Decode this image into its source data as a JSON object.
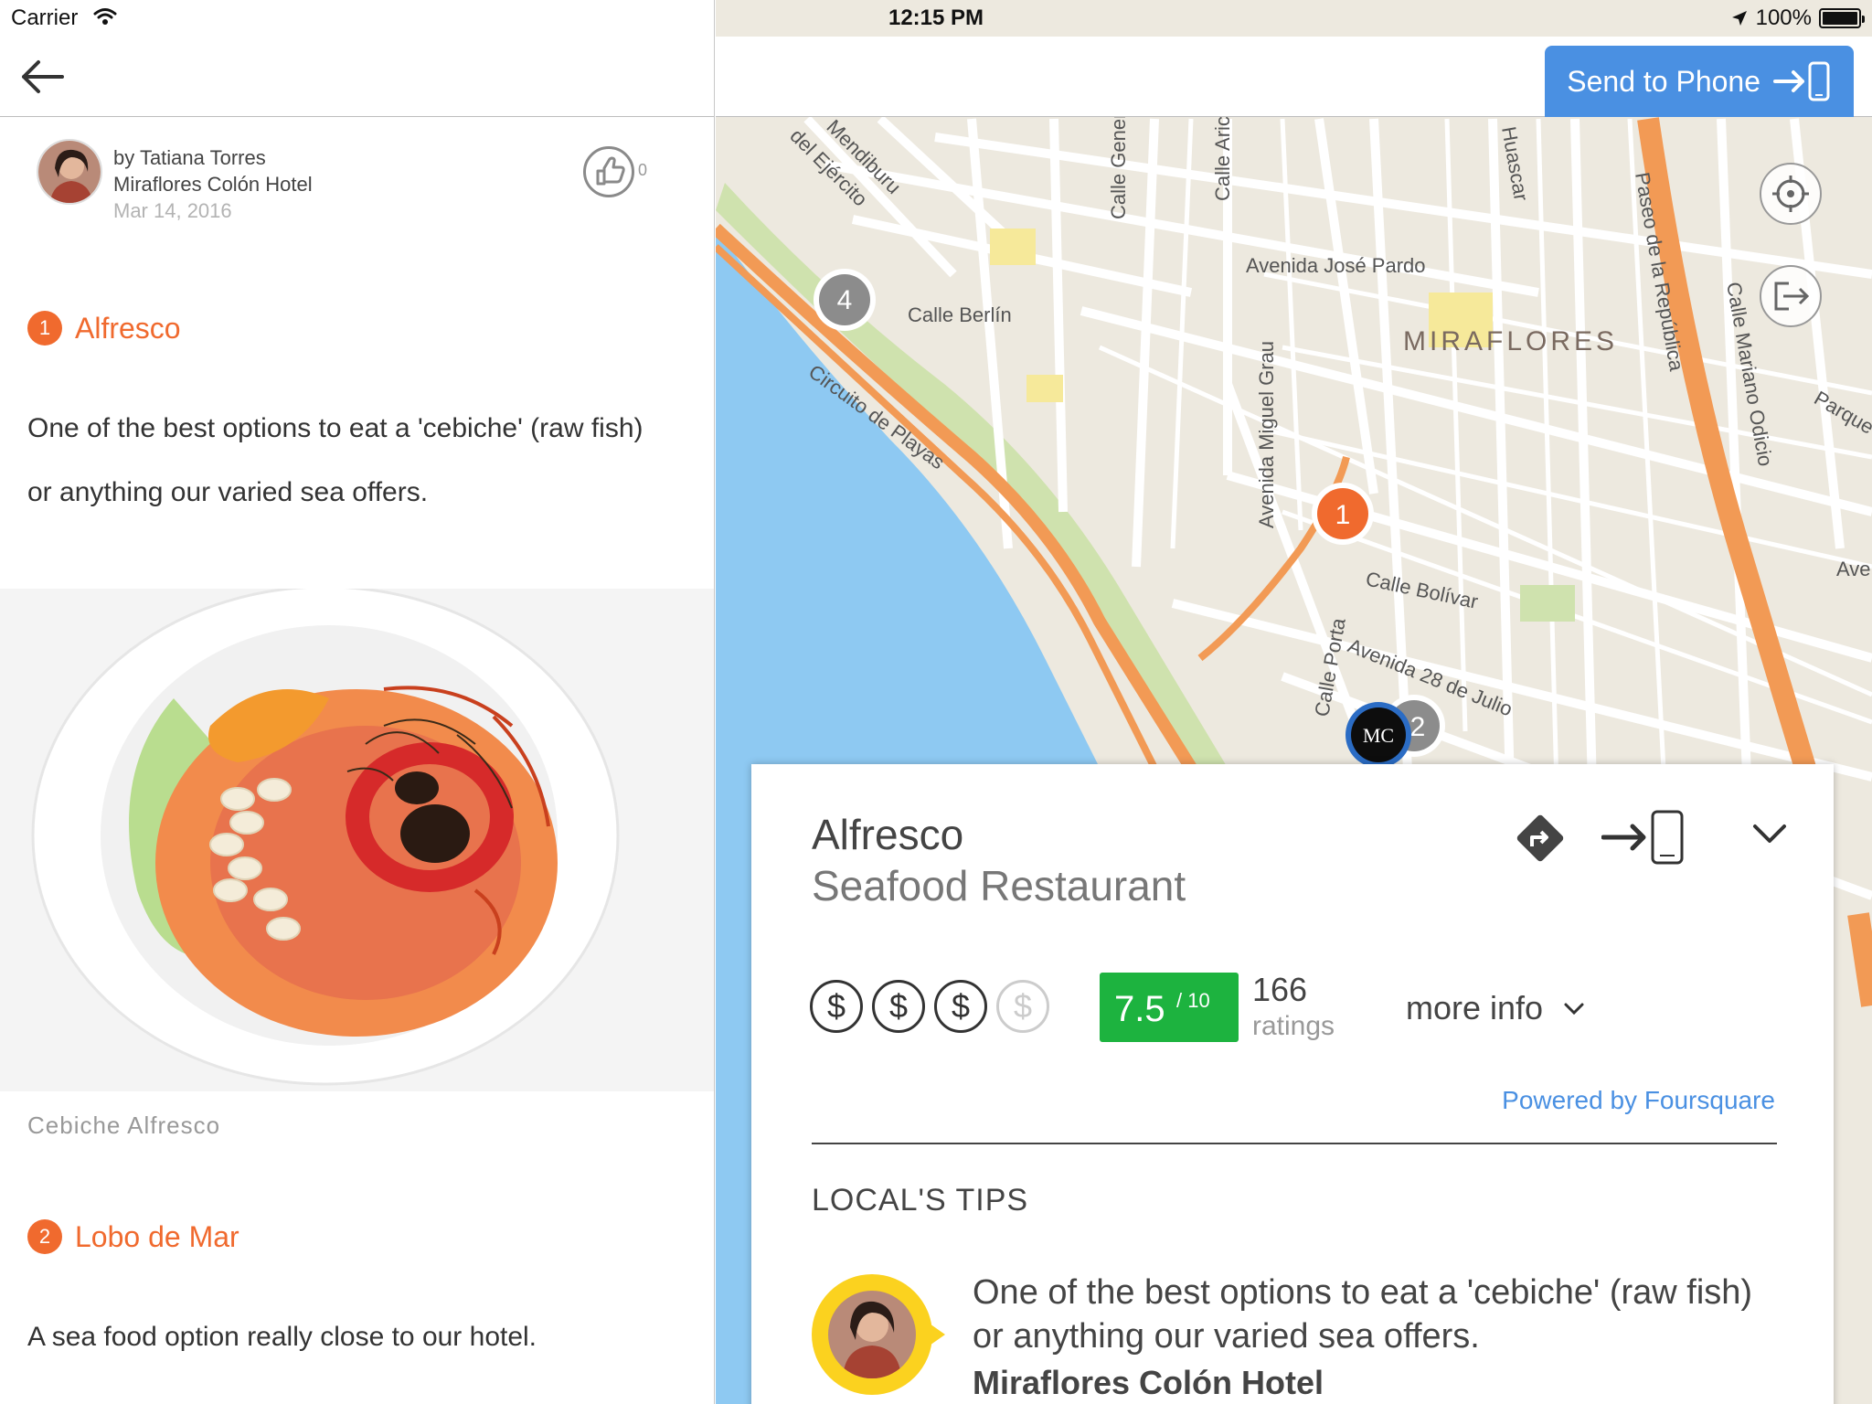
{
  "status_bar": {
    "carrier": "Carrier",
    "time": "12:15 PM",
    "battery": "100%"
  },
  "post": {
    "byline": "by Tatiana Torres",
    "hotel": "Miraflores Colón Hotel",
    "date": "Mar 14, 2016",
    "likes": "0"
  },
  "places": [
    {
      "number": "1",
      "name": "Alfresco",
      "description": "One of the best options to eat a 'cebiche' (raw fish) or anything our varied sea offers.",
      "photo_caption": "Cebiche Alfresco"
    },
    {
      "number": "2",
      "name": "Lobo de Mar",
      "description": "A sea food option really close to our hotel."
    }
  ],
  "map": {
    "send_to_phone_label": "Send to Phone",
    "district_label": "MIRAFLORES",
    "street_labels": {
      "jose_pardo": "Avenida José Pardo",
      "berlin": "Calle Berlín",
      "circuito": "Circuito de Playas",
      "bolivar": "Calle Bolívar",
      "veintiocho": "Avenida 28 de Julio",
      "grau": "Avenida Miguel Grau",
      "porta": "Calle Porta",
      "republica": "Paseo de la República",
      "odicio": "Calle Mariano Odicio",
      "mendiburu": "Mendiburu",
      "ejercito": "del Ejército",
      "general": "Calle Gener",
      "arica": "Calle Aric",
      "huascar": "Huascar",
      "parque": "Parque",
      "avenida_edge": "Aven"
    },
    "markers": [
      {
        "label": "4"
      },
      {
        "label": "1"
      },
      {
        "label": "2"
      }
    ],
    "hotel_pin_label": "MC"
  },
  "venue_card": {
    "name": "Alfresco",
    "category": "Seafood Restaurant",
    "price_tier": 3,
    "price_max": 4,
    "price_symbol": "$",
    "rating": "7.5",
    "rating_scale": "/ 10",
    "ratings_count": "166",
    "ratings_label": "ratings",
    "more_info_label": "more info",
    "powered_by": "Powered by Foursquare",
    "tips_heading": "LOCAL'S TIPS",
    "tip_text": "One of the best options to eat a 'cebiche' (raw fish) or anything our varied sea offers.",
    "tip_author": "Miraflores Colón Hotel"
  },
  "colors": {
    "accent": "#f06a2e",
    "button_blue": "#4a90e2",
    "rating_green": "#1db33f",
    "water": "#8ec9f2"
  }
}
